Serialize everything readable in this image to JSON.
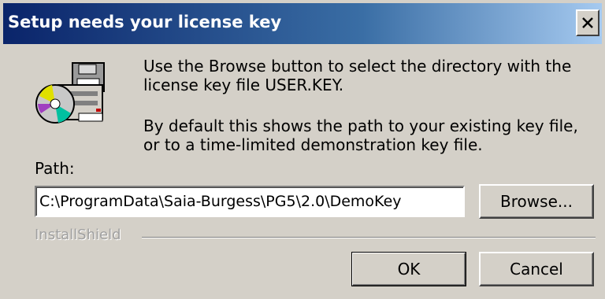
{
  "window": {
    "title": "Setup needs your license key"
  },
  "icons": {
    "setup": "install-disk-icon",
    "close": "close-icon"
  },
  "message": {
    "line1": "Use the Browse button to select the directory with the license key file USER.KEY.",
    "line2": "By default this shows the path to your existing key file, or to a time-limited demonstration key file."
  },
  "path": {
    "label": "Path:",
    "value": "C:\\ProgramData\\Saia-Burgess\\PG5\\2.0\\DemoKey"
  },
  "buttons": {
    "browse": "Browse...",
    "ok": "OK",
    "cancel": "Cancel"
  },
  "footer": {
    "brand": "InstallShield"
  }
}
